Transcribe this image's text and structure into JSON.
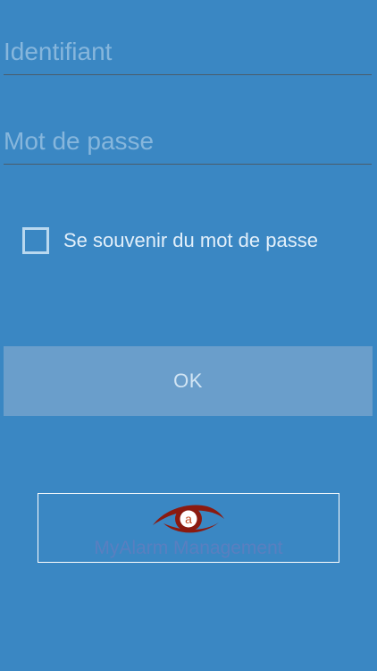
{
  "login_form": {
    "username": {
      "placeholder": "Identifiant",
      "value": ""
    },
    "password": {
      "placeholder": "Mot de passe",
      "value": ""
    },
    "remember": {
      "label": "Se souvenir du mot de passe",
      "checked": false
    },
    "submit_label": "OK"
  },
  "branding": {
    "name": "MyAlarm Management",
    "logo_icon": "eye-logo-icon",
    "logo_letter": "a"
  },
  "colors": {
    "background": "#3a87c3",
    "button": "#6a9ecb",
    "logo_red": "#8b1a10",
    "brand_text": "#5a7fc0"
  }
}
